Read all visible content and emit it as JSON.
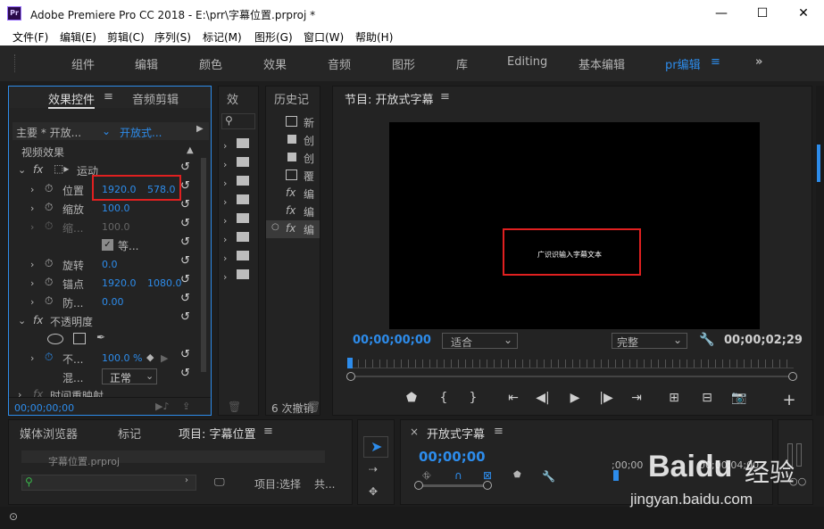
{
  "titlebar": {
    "logo": "Pr",
    "title": "Adobe Premiere Pro CC 2018 - E:\\prr\\字幕位置.prproj *",
    "minimize": "—",
    "maximize": "☐",
    "close": "✕"
  },
  "menu": [
    "文件(F)",
    "编辑(E)",
    "剪辑(C)",
    "序列(S)",
    "标记(M)",
    "图形(G)",
    "窗口(W)",
    "帮助(H)"
  ],
  "workspaces": [
    "组件",
    "编辑",
    "颜色",
    "效果",
    "音频",
    "图形",
    "库",
    "Editing",
    "基本编辑",
    "pr编辑"
  ],
  "workspace_active": "pr编辑",
  "workspace_menu": "≡",
  "workspace_more": "»",
  "effect_controls": {
    "tab": "效果控件",
    "tab_menu": "≡",
    "tab2": "音频剪辑",
    "master": "主要 * 开放...",
    "clip": "开放式...",
    "section": "视频效果",
    "motion": "运动",
    "position_label": "位置",
    "position_x": "1920.0",
    "position_y": "578.0",
    "scale_label": "缩放",
    "scale_val": "100.0",
    "scale_w_label": "缩...",
    "scale_w_val": "100.0",
    "uniform_label": "等...",
    "rotation_label": "旋转",
    "rotation_val": "0.0",
    "anchor_label": "锚点",
    "anchor_x": "1920.0",
    "anchor_y": "1080.0",
    "anti_label": "防...",
    "anti_val": "0.00",
    "opacity": "不透明度",
    "opacity_label": "不...",
    "opacity_val": "100.0 %",
    "blend_label": "混...",
    "blend_val": "正常",
    "time_remap": "时间重映射",
    "timecode": "00;00;00;00"
  },
  "effects_panel": {
    "tab": "效"
  },
  "history": {
    "tab": "历史记",
    "items": [
      {
        "icon": "list-icon",
        "label": "新"
      },
      {
        "icon": "clip-icon",
        "label": "创"
      },
      {
        "icon": "clip-icon",
        "label": "创"
      },
      {
        "icon": "list-icon",
        "label": "覆"
      },
      {
        "icon": "fx-icon",
        "label": "编"
      },
      {
        "icon": "fx-icon",
        "label": "编"
      },
      {
        "icon": "fx-icon",
        "label": "编"
      }
    ],
    "footer": "6 次撤销"
  },
  "program": {
    "tab": "节目: 开放式字幕",
    "tab_menu": "≡",
    "caption": "广识识输入字幕文本",
    "timecode": "00;00;00;00",
    "fit": "适合",
    "quality": "完整",
    "duration": "00;00;02;29"
  },
  "project_panel": {
    "tabs": [
      "媒体浏览器",
      "标记",
      "项目: 字幕位置"
    ],
    "tab_menu": "≡",
    "item": "字幕位置.prproj",
    "footer_text": "项目:选择",
    "footer_text2": "共..."
  },
  "timeline": {
    "close": "×",
    "tab": "开放式字幕",
    "tab_menu": "≡",
    "timecode": "00;00;00",
    "ruler1": ";00;00",
    "ruler2": "00;00;04;00"
  },
  "watermark": {
    "brand": "Baidu",
    "brand_cn": "经验",
    "url": "jingyan.baidu.com"
  },
  "colors": {
    "accent": "#2d8ceb",
    "highlight": "#e02020",
    "bg": "#232323"
  }
}
